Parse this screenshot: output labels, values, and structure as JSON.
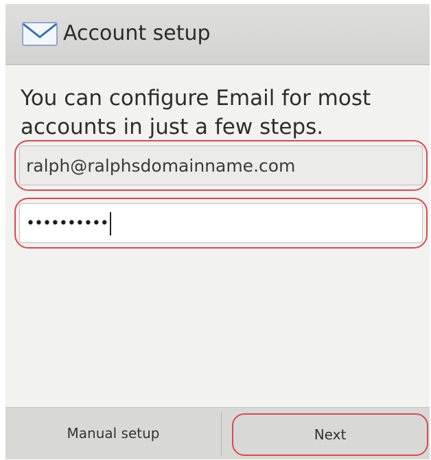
{
  "header": {
    "icon": "mail-envelope-icon",
    "title": "Account setup"
  },
  "intro_text": "You can configure Email for most accounts in just a few steps.",
  "form": {
    "email": {
      "value": "ralph@ralphsdomainname.com"
    },
    "password": {
      "masked_value": "••••••••••"
    }
  },
  "footer": {
    "manual_setup_label": "Manual setup",
    "next_label": "Next"
  },
  "colors": {
    "highlight": "#d94a4a",
    "header_bg": "#d8d8d7",
    "screen_bg": "#f2f2f1"
  }
}
